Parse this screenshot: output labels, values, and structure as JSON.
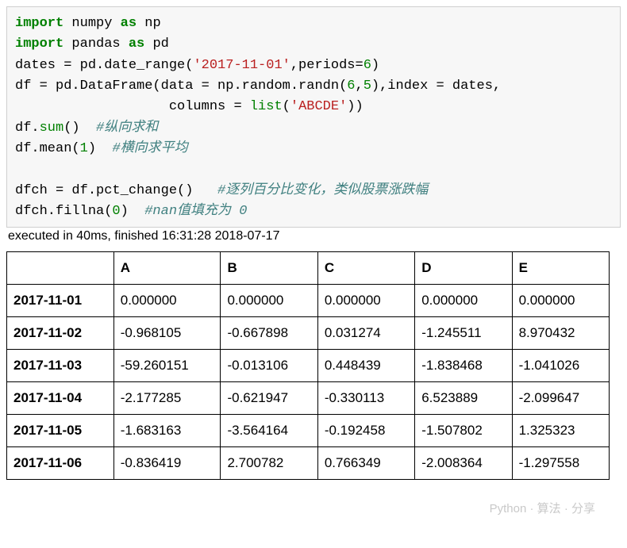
{
  "code": {
    "line1_import": "import",
    "line1_numpy": " numpy ",
    "line1_as": "as",
    "line1_np": " np",
    "line2_import": "import",
    "line2_pandas": " pandas ",
    "line2_as": "as",
    "line2_pd": " pd",
    "line3_pre": "dates = pd.date_range(",
    "line3_str": "'2017-11-01'",
    "line3_mid": ",periods=",
    "line3_num": "6",
    "line3_post": ")",
    "line4_pre": "df = pd.DataFrame(data = np.random.randn(",
    "line4_n1": "6",
    "line4_c": ",",
    "line4_n2": "5",
    "line4_post": "),index = dates,",
    "line5_pre": "                   columns = ",
    "line5_list": "list",
    "line5_open": "(",
    "line5_str": "'ABCDE'",
    "line5_close": "))",
    "line6_pre": "df.",
    "line6_sum": "sum",
    "line6_post": "()  ",
    "line6_comment": "#纵向求和",
    "line7_pre": "df.mean(",
    "line7_num": "1",
    "line7_post": ")  ",
    "line7_comment": "#横向求平均",
    "blank": "",
    "line8_pre": "dfch = df.pct_change()   ",
    "line8_comment": "#逐列百分比变化，类似股票涨跌幅",
    "line9_pre": "dfch.fillna(",
    "line9_num": "0",
    "line9_post": ")  ",
    "line9_comment": "#nan值填充为 0"
  },
  "exec_status": "executed in 40ms, finished 16:31:28 2018-07-17",
  "table": {
    "columns": [
      "A",
      "B",
      "C",
      "D",
      "E"
    ],
    "index": [
      "2017-11-01",
      "2017-11-02",
      "2017-11-03",
      "2017-11-04",
      "2017-11-05",
      "2017-11-06"
    ],
    "rows": [
      [
        "0.000000",
        "0.000000",
        "0.000000",
        "0.000000",
        "0.000000"
      ],
      [
        "-0.968105",
        "-0.667898",
        "0.031274",
        "-1.245511",
        "8.970432"
      ],
      [
        "-59.260151",
        "-0.013106",
        "0.448439",
        "-1.838468",
        "-1.041026"
      ],
      [
        "-2.177285",
        "-0.621947",
        "-0.330113",
        "6.523889",
        "-2.099647"
      ],
      [
        "-1.683163",
        "-3.564164",
        "-0.192458",
        "-1.507802",
        "1.325323"
      ],
      [
        "-0.836419",
        "2.700782",
        "0.766349",
        "-2.008364",
        "-1.297558"
      ]
    ]
  },
  "watermark": "Python · 算法 · 分享"
}
